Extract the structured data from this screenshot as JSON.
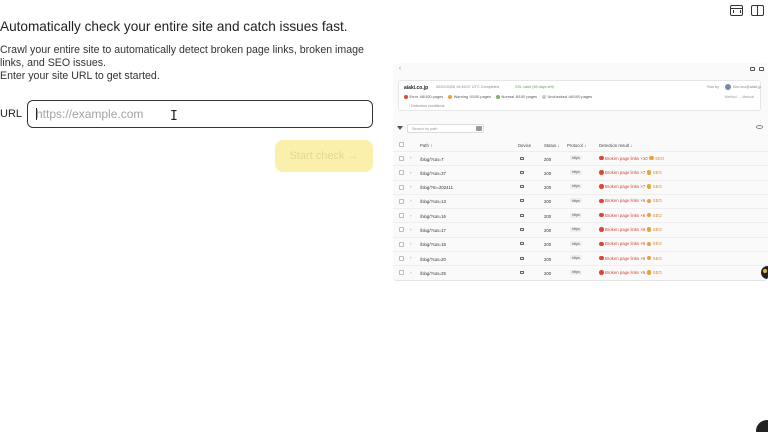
{
  "page": {
    "headline": "Automatically check your entire site and catch issues fast.",
    "description_line1": "Crawl your entire site to automatically detect broken page links, broken image links, and SEO issues.",
    "description_line2": "Enter your site URL to get started.",
    "url_label": "URL",
    "url_placeholder": "https://example.com",
    "url_value": "",
    "start_button": "Start check →"
  },
  "preview": {
    "summary": {
      "domain": "aiaki.co.jp",
      "date_status": "20/02/2026 19:46:07 UTC Completed",
      "ssl": "SSL valid (38 days left)",
      "run_by_label": "Run by",
      "user": "Kito.ono@aiaki.jp",
      "stats": [
        {
          "label": "Error",
          "value": "48/100 pages",
          "color": "#d94a36"
        },
        {
          "label": "Warning",
          "value": "0/100 pages",
          "color": "#e8a33d"
        },
        {
          "label": "Normal",
          "value": "8/100 pages",
          "color": "#7fb069"
        },
        {
          "label": "Unchecked",
          "value": "46/100 pages",
          "color": "#c8c8c8"
        }
      ],
      "method": "Method → Manual",
      "conditions": "Detection conditions"
    },
    "search_placeholder": "Search by path",
    "columns": {
      "path": "Path ↑",
      "device": "Device",
      "status": "Status ↓",
      "protocol": "Protocol ↓",
      "detection": "Detection result ↓"
    },
    "rows": [
      {
        "path": "/blog/?cat=7",
        "status": "200",
        "protocol": "https",
        "result": "Broken page links ×10",
        "seo": "SEO"
      },
      {
        "path": "/blog/?cat=37",
        "status": "200",
        "protocol": "https",
        "result": "Broken page links ×7",
        "seo": "SEO"
      },
      {
        "path": "/blog/?m=202411",
        "status": "200",
        "protocol": "https",
        "result": "Broken page links ×7",
        "seo": "SEO"
      },
      {
        "path": "/blog/?cat=13",
        "status": "200",
        "protocol": "https",
        "result": "Broken page links ×6",
        "seo": "SEO"
      },
      {
        "path": "/blog/?cat=16",
        "status": "200",
        "protocol": "https",
        "result": "Broken page links ×6",
        "seo": "SEO"
      },
      {
        "path": "/blog/?cat=17",
        "status": "200",
        "protocol": "https",
        "result": "Broken page links ×6",
        "seo": "SEO"
      },
      {
        "path": "/blog/?cat=18",
        "status": "200",
        "protocol": "https",
        "result": "Broken page links ×6",
        "seo": "SEO"
      },
      {
        "path": "/blog/?cat=20",
        "status": "200",
        "protocol": "https",
        "result": "Broken page links ×6",
        "seo": "SEO"
      },
      {
        "path": "/blog/?cat=25",
        "status": "200",
        "protocol": "https",
        "result": "Broken page links ×6",
        "seo": "SEO"
      }
    ]
  },
  "colors": {
    "accent_button": "#fbefac",
    "error": "#d94a36",
    "seo": "#e8a33d"
  }
}
